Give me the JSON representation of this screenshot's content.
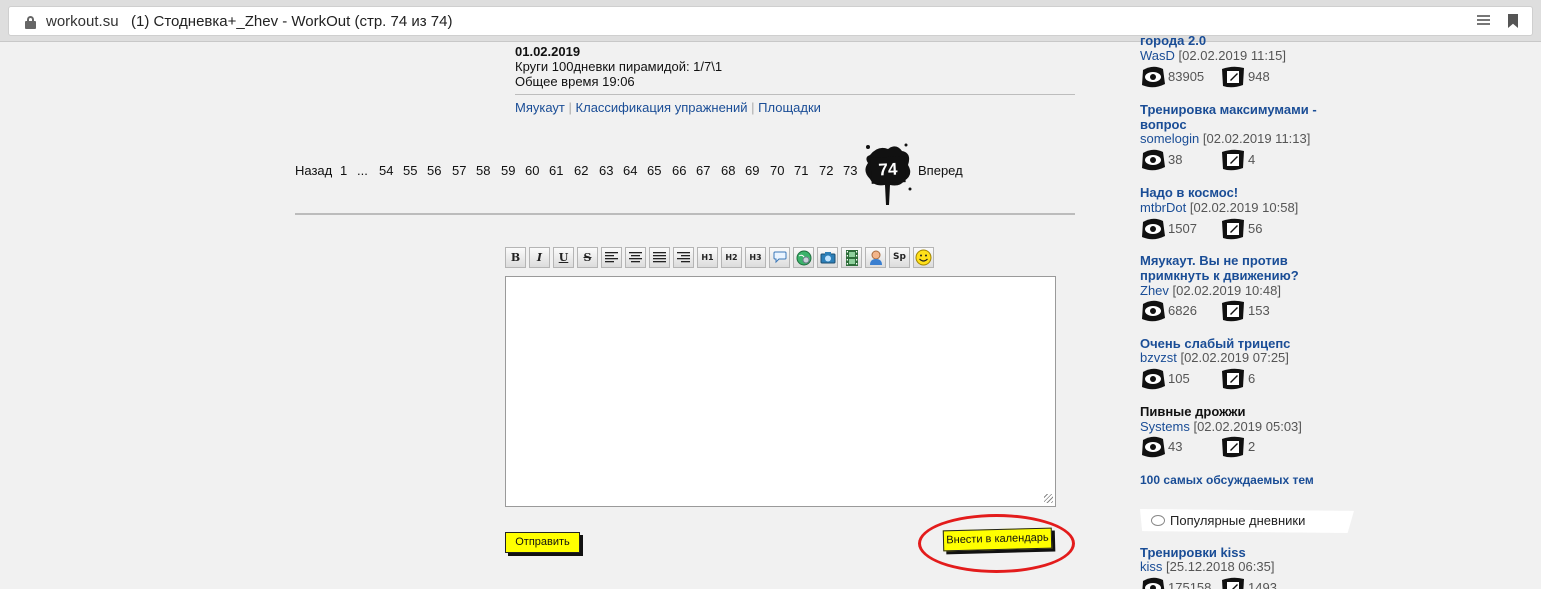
{
  "browser": {
    "url": "workout.su",
    "title": "(1) Стодневка+_Zhev - WorkOut (стр. 74 из 74)"
  },
  "post": {
    "date": "01.02.2019",
    "lines": [
      "Круги 100дневки пирамидой: 1/7\\1",
      "Общее время 19:06"
    ],
    "links": [
      "Мяукаут",
      "Классификация упражнений",
      "Площадки"
    ],
    "link_separator": "|"
  },
  "pager": {
    "prev": "Назад",
    "first": "1",
    "ellipsis": "...",
    "pages": [
      "54",
      "55",
      "56",
      "57",
      "58",
      "59",
      "60",
      "61",
      "62",
      "63",
      "64",
      "65",
      "66",
      "67",
      "68",
      "69",
      "70",
      "71",
      "72",
      "73"
    ],
    "current": "74",
    "next": "Вперед"
  },
  "editor": {
    "toolbar": [
      {
        "name": "bold-button",
        "label": "B"
      },
      {
        "name": "italic-button",
        "label": "I"
      },
      {
        "name": "underline-button",
        "label": "U"
      },
      {
        "name": "strikethrough-button",
        "label": "S"
      },
      {
        "name": "align-left-button",
        "label": ""
      },
      {
        "name": "align-center-button",
        "label": ""
      },
      {
        "name": "align-justify-button",
        "label": ""
      },
      {
        "name": "align-right-button",
        "label": ""
      },
      {
        "name": "heading1-button",
        "label": "H1"
      },
      {
        "name": "heading2-button",
        "label": "H2"
      },
      {
        "name": "heading3-button",
        "label": "H3"
      },
      {
        "name": "quote-button",
        "label": ""
      },
      {
        "name": "link-button",
        "label": ""
      },
      {
        "name": "image-button",
        "label": ""
      },
      {
        "name": "video-button",
        "label": ""
      },
      {
        "name": "user-button",
        "label": ""
      },
      {
        "name": "spoiler-button",
        "label": "Sp"
      },
      {
        "name": "smiley-button",
        "label": ""
      }
    ],
    "text": "",
    "submit_label": "Отправить",
    "calendar_label": "Внести в календарь"
  },
  "sidebar": {
    "topics": [
      {
        "title": "города 2.0",
        "author": "WasD",
        "date": "[02.02.2019 11:15]",
        "views": "83905",
        "comments": "948",
        "link": true
      },
      {
        "title": "Тренировка максимумами - вопрос",
        "author": "somelogin",
        "date": "[02.02.2019 11:13]",
        "views": "38",
        "comments": "4",
        "link": true
      },
      {
        "title": "Надо в космос!",
        "author": "mtbrDot",
        "date": "[02.02.2019 10:58]",
        "views": "1507",
        "comments": "56",
        "link": true
      },
      {
        "title": "Мяукаут. Вы не против примкнуть к движению?",
        "author": "Zhev",
        "date": "[02.02.2019 10:48]",
        "views": "6826",
        "comments": "153",
        "link": true
      },
      {
        "title": "Очень слабый трицепс",
        "author": "bzvzst",
        "date": "[02.02.2019 07:25]",
        "views": "105",
        "comments": "6",
        "link": true
      },
      {
        "title": "Пивные дрожжи",
        "author": "Systems",
        "date": "[02.02.2019 05:03]",
        "views": "43",
        "comments": "2",
        "link": false
      }
    ],
    "top100": "100 самых обсуждаемых тем",
    "popular_header": "Популярные дневники",
    "popular": [
      {
        "title": "Тренировки kiss",
        "author": "kiss",
        "date": "[25.12.2018 06:35]",
        "views": "175158",
        "comments": "1493"
      }
    ]
  },
  "colors": {
    "link": "#1a4d96",
    "button": "#ffff00",
    "highlight": "#e31c1c",
    "background": "#f1f1f1"
  }
}
